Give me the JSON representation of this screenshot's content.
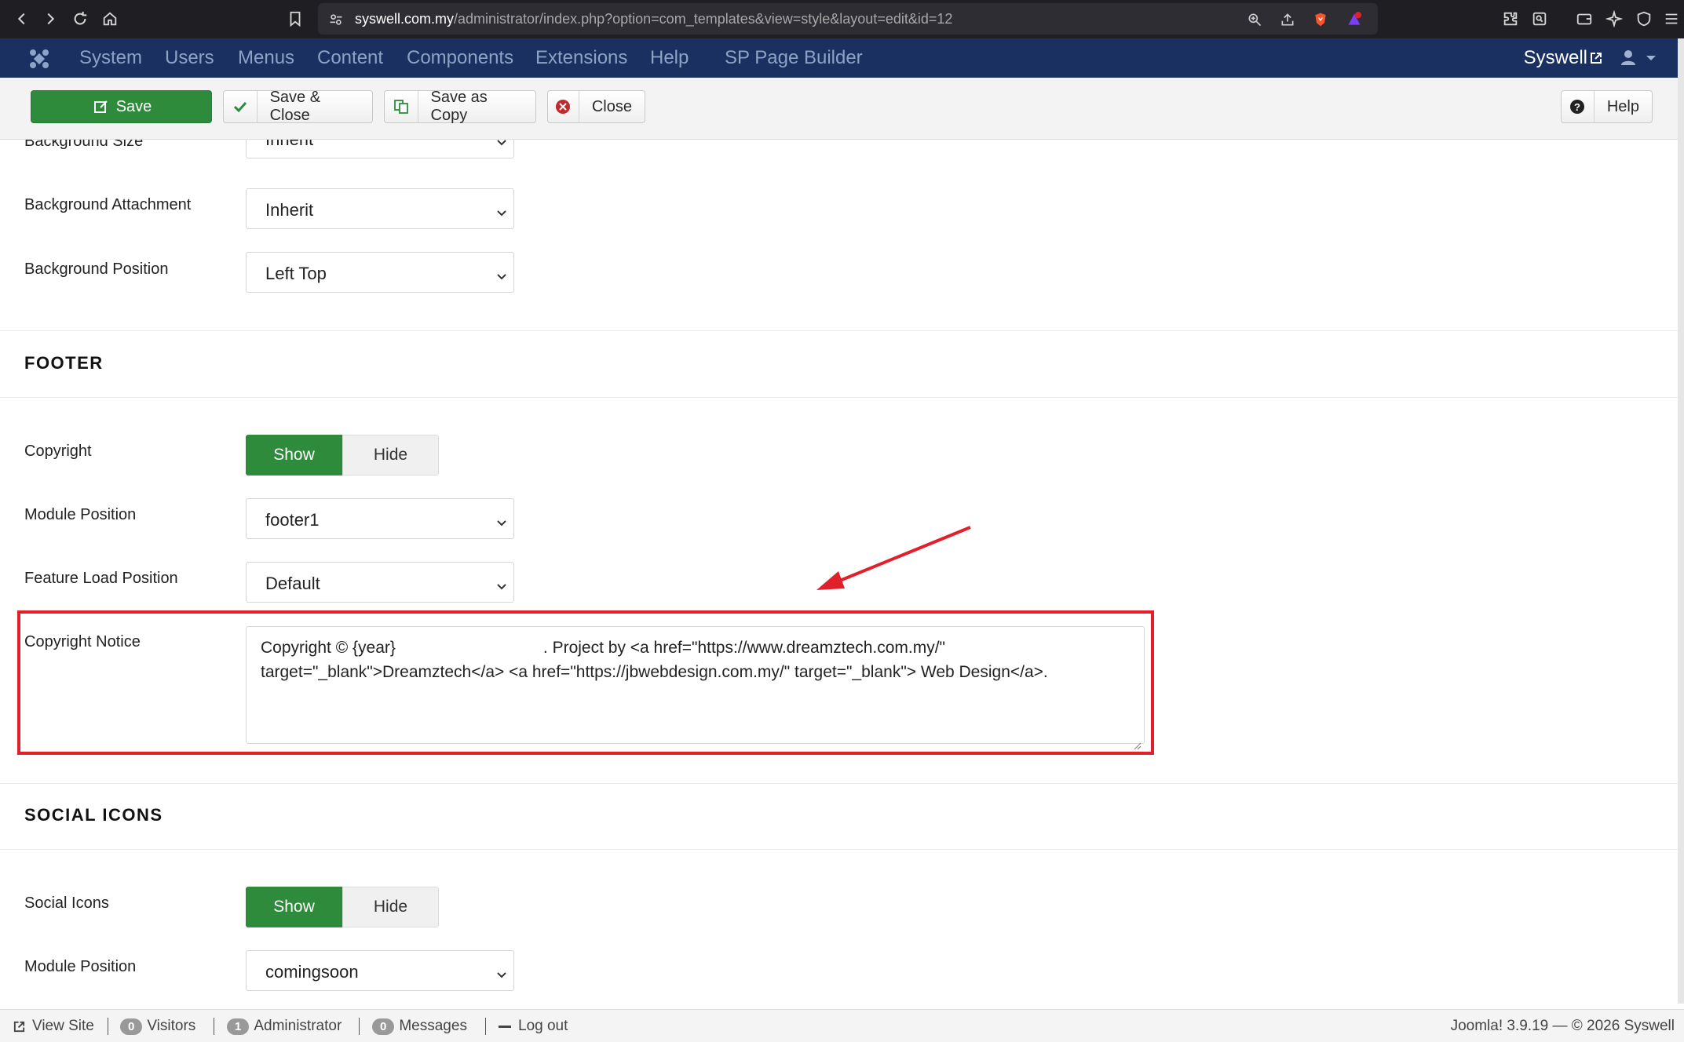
{
  "browser": {
    "url_host": "syswell.com.my",
    "url_rest": "/administrator/index.php?option=com_templates&view=style&layout=edit&id=12",
    "notification_count": "1"
  },
  "admin_nav": {
    "items": [
      "System",
      "Users",
      "Menus",
      "Content",
      "Components",
      "Extensions",
      "Help",
      "SP Page Builder"
    ],
    "site_name": "Syswell"
  },
  "toolbar": {
    "save": "Save",
    "save_close": "Save & Close",
    "save_copy": "Save as Copy",
    "close": "Close",
    "help": "Help"
  },
  "background": {
    "size_label": "Background Size",
    "size_value": "Inherit",
    "attachment_label": "Background Attachment",
    "attachment_value": "Inherit",
    "position_label": "Background Position",
    "position_value": "Left Top"
  },
  "footer": {
    "title": "FOOTER",
    "copyright_label": "Copyright",
    "copyright_on": "Show",
    "copyright_off": "Hide",
    "module_position_label": "Module Position",
    "module_position_value": "footer1",
    "feature_load_label": "Feature Load Position",
    "feature_load_value": "Default",
    "notice_label": "Copyright Notice",
    "notice_part1": "Copyright © {year}",
    "notice_part2": ". Project by <a href=\"https://www.dreamztech.com.my/\"",
    "notice_line2": "target=\"_blank\">Dreamztech</a> <a href=\"https://jbwebdesign.com.my/\" target=\"_blank\"> Web Design</a>."
  },
  "social": {
    "title": "SOCIAL ICONS",
    "icons_label": "Social Icons",
    "icons_on": "Show",
    "icons_off": "Hide",
    "module_position_label": "Module Position",
    "module_position_value": "comingsoon"
  },
  "statusbar": {
    "view_site": "View Site",
    "visitors_count": "0",
    "visitors": "Visitors",
    "admin_count": "1",
    "admin": "Administrator",
    "messages_count": "0",
    "messages": "Messages",
    "logout": "Log out",
    "footer": "Joomla! 3.9.19  —  © 2026 Syswell"
  },
  "colors": {
    "nav_bg": "#1a3060",
    "save_green": "#2e8b3c",
    "highlight_red": "#e0202a"
  }
}
